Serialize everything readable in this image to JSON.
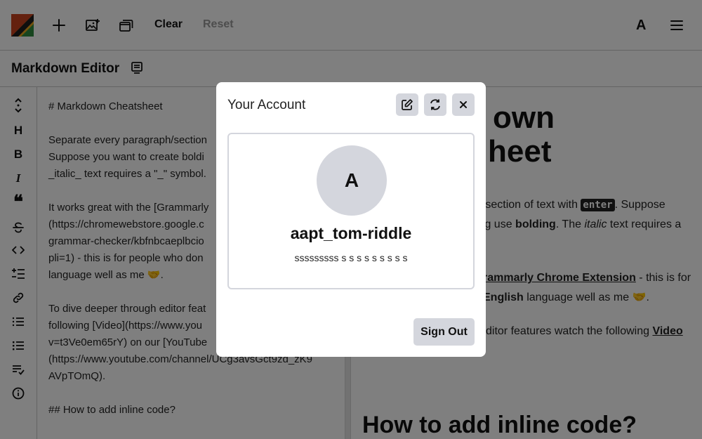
{
  "toolbar": {
    "clear_label": "Clear",
    "reset_label": "Reset",
    "font_label": "A"
  },
  "header": {
    "title": "Markdown Editor"
  },
  "editor": {
    "lines": [
      "# Markdown Cheatsheet",
      "",
      "Separate every paragraph/section",
      "Suppose you want to create boldi",
      "_italic_ text requires a \"_\" symbol.",
      "",
      "It works great with the [Grammarly",
      "(https://chromewebstore.google.c",
      "grammar-checker/kbfnbcaeplbcio",
      "pli=1) - this is for people who don",
      "language well as me 🤝.",
      "",
      "To dive deeper through editor feat",
      "following [Video](https://www.you",
      "v=t3Ve0em65rY) on our [YouTube",
      "(https://www.youtube.com/channel/UCg3avsGct9zd_zK9",
      "AVpTOmQ).",
      "",
      "## How to add inline code?"
    ]
  },
  "preview": {
    "h1_line1": "own",
    "h1_line2": "heet",
    "p1_a": "n/section of text with ",
    "p1_code": "enter",
    "p1_b": ". Suppose",
    "p2_a": "ing use ",
    "p2_bold": "bolding",
    "p2_b": ". The ",
    "p2_italic": "italic",
    "p2_c": " text requires a",
    "p3_link": "rammarly Chrome Extension",
    "p3_b": " - this is for",
    "p4_bold": "English",
    "p4_b": " language well as me 🤝.",
    "p5_a": "ditor features watch the following ",
    "p5_link": "Video",
    "h2": "How to add inline code?"
  },
  "modal": {
    "title": "Your Account",
    "avatar_initial": "A",
    "username": "aapt_tom-riddle",
    "bio": "sssssssss s s s s s s s s s",
    "sign_out_label": "Sign Out"
  },
  "colors": {
    "overlay": "rgba(0,0,0,0.5)",
    "button_gray": "#d4d6dd",
    "border_gray": "#c9c9c9"
  }
}
